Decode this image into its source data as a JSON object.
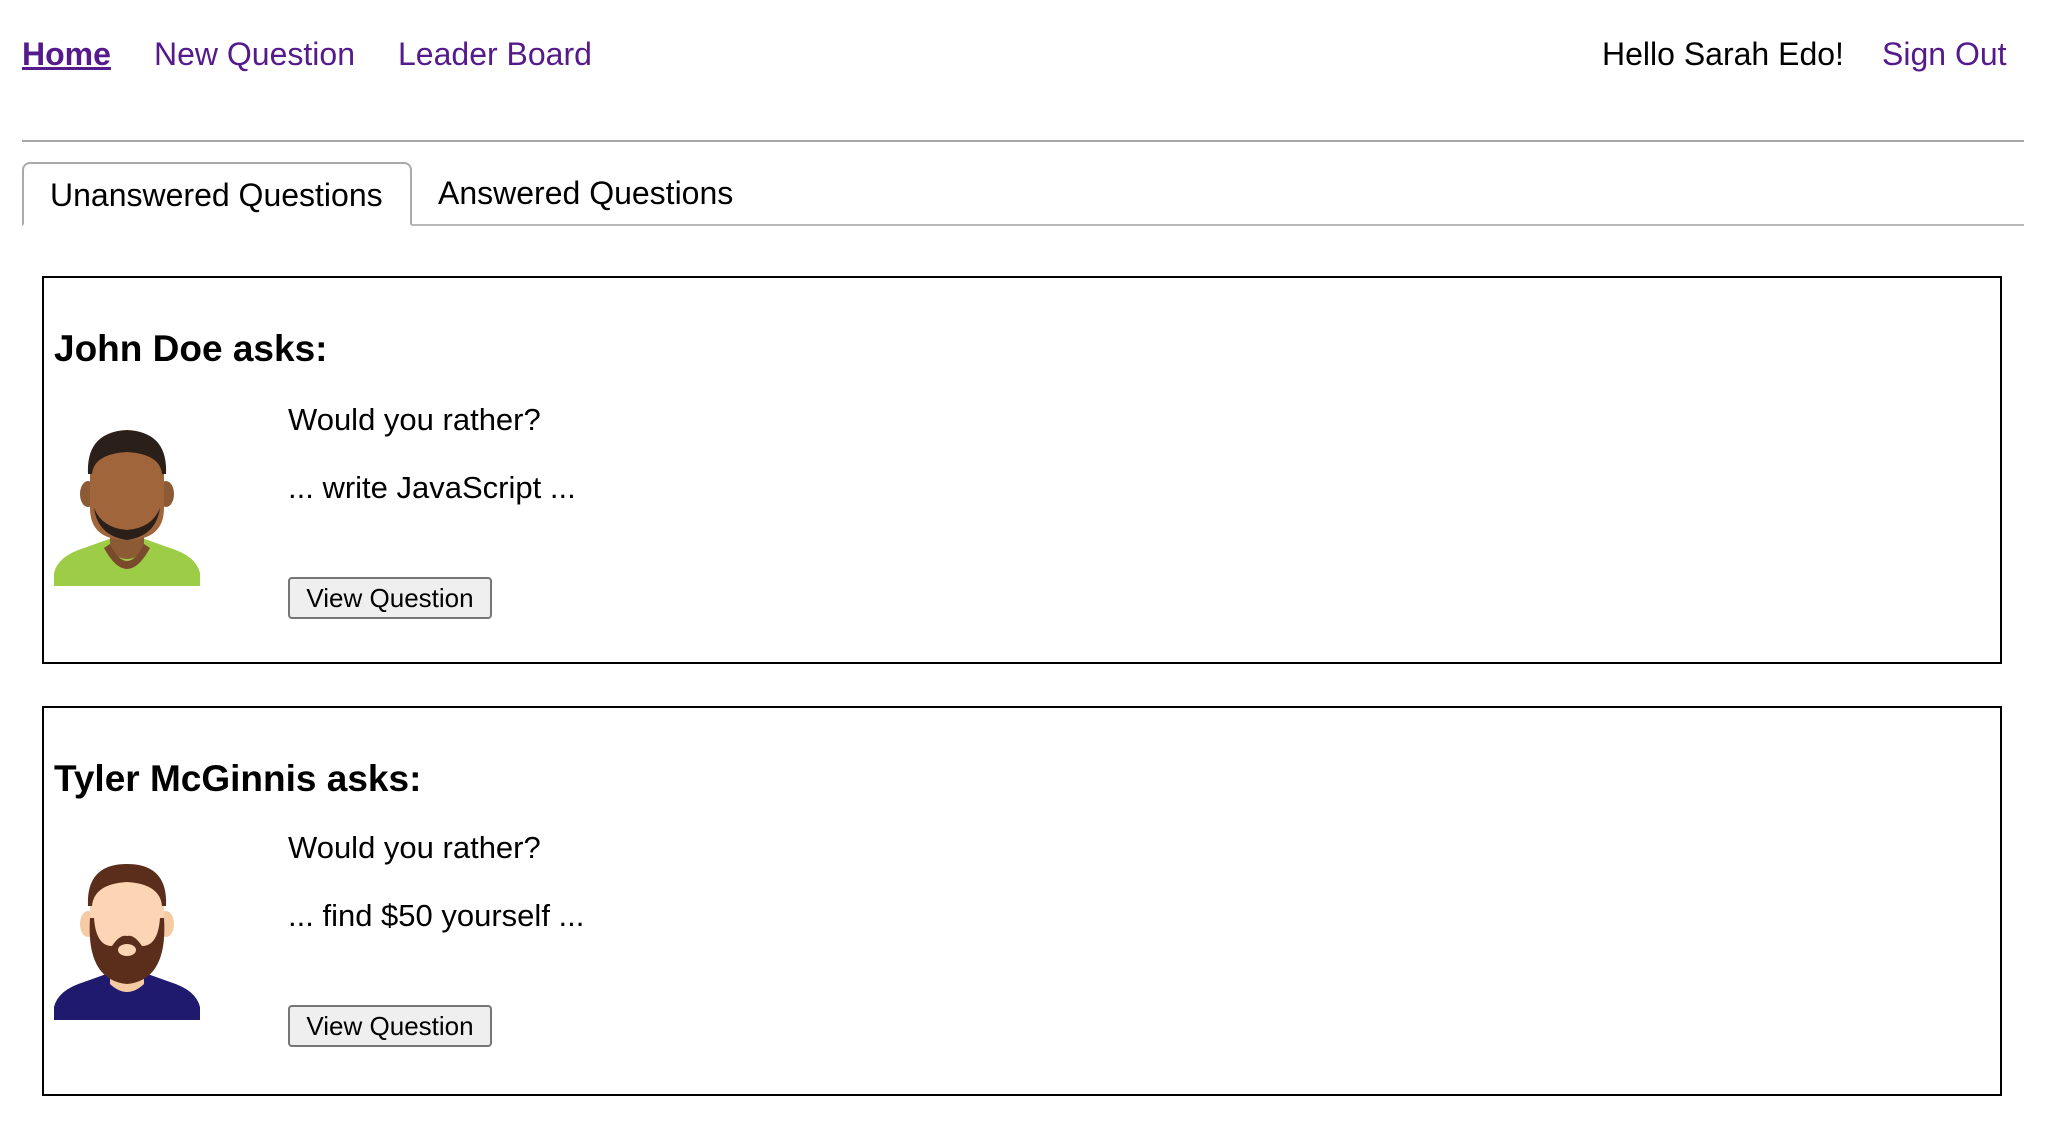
{
  "nav": {
    "home": "Home",
    "new_question": "New Question",
    "leader_board": "Leader Board",
    "greeting": "Hello Sarah Edo!",
    "sign_out": "Sign Out"
  },
  "tabs": [
    {
      "label": "Unanswered Questions",
      "selected": true
    },
    {
      "label": "Answered Questions",
      "selected": false
    }
  ],
  "questions": [
    {
      "author_heading": "John Doe asks:",
      "avatar": "avatar-dark-skin-green-shirt-icon",
      "prompt": "Would you rather?",
      "option_preview": "... write JavaScript ...",
      "button": "View Question"
    },
    {
      "author_heading": "Tyler McGinnis asks:",
      "avatar": "avatar-bearded-navy-shirt-icon",
      "prompt": "Would you rather?",
      "option_preview": "... find $50 yourself ...",
      "button": "View Question"
    }
  ],
  "colors": {
    "link": "#551a8b",
    "card_border": "#000000",
    "divider": "#a8a8a8"
  }
}
